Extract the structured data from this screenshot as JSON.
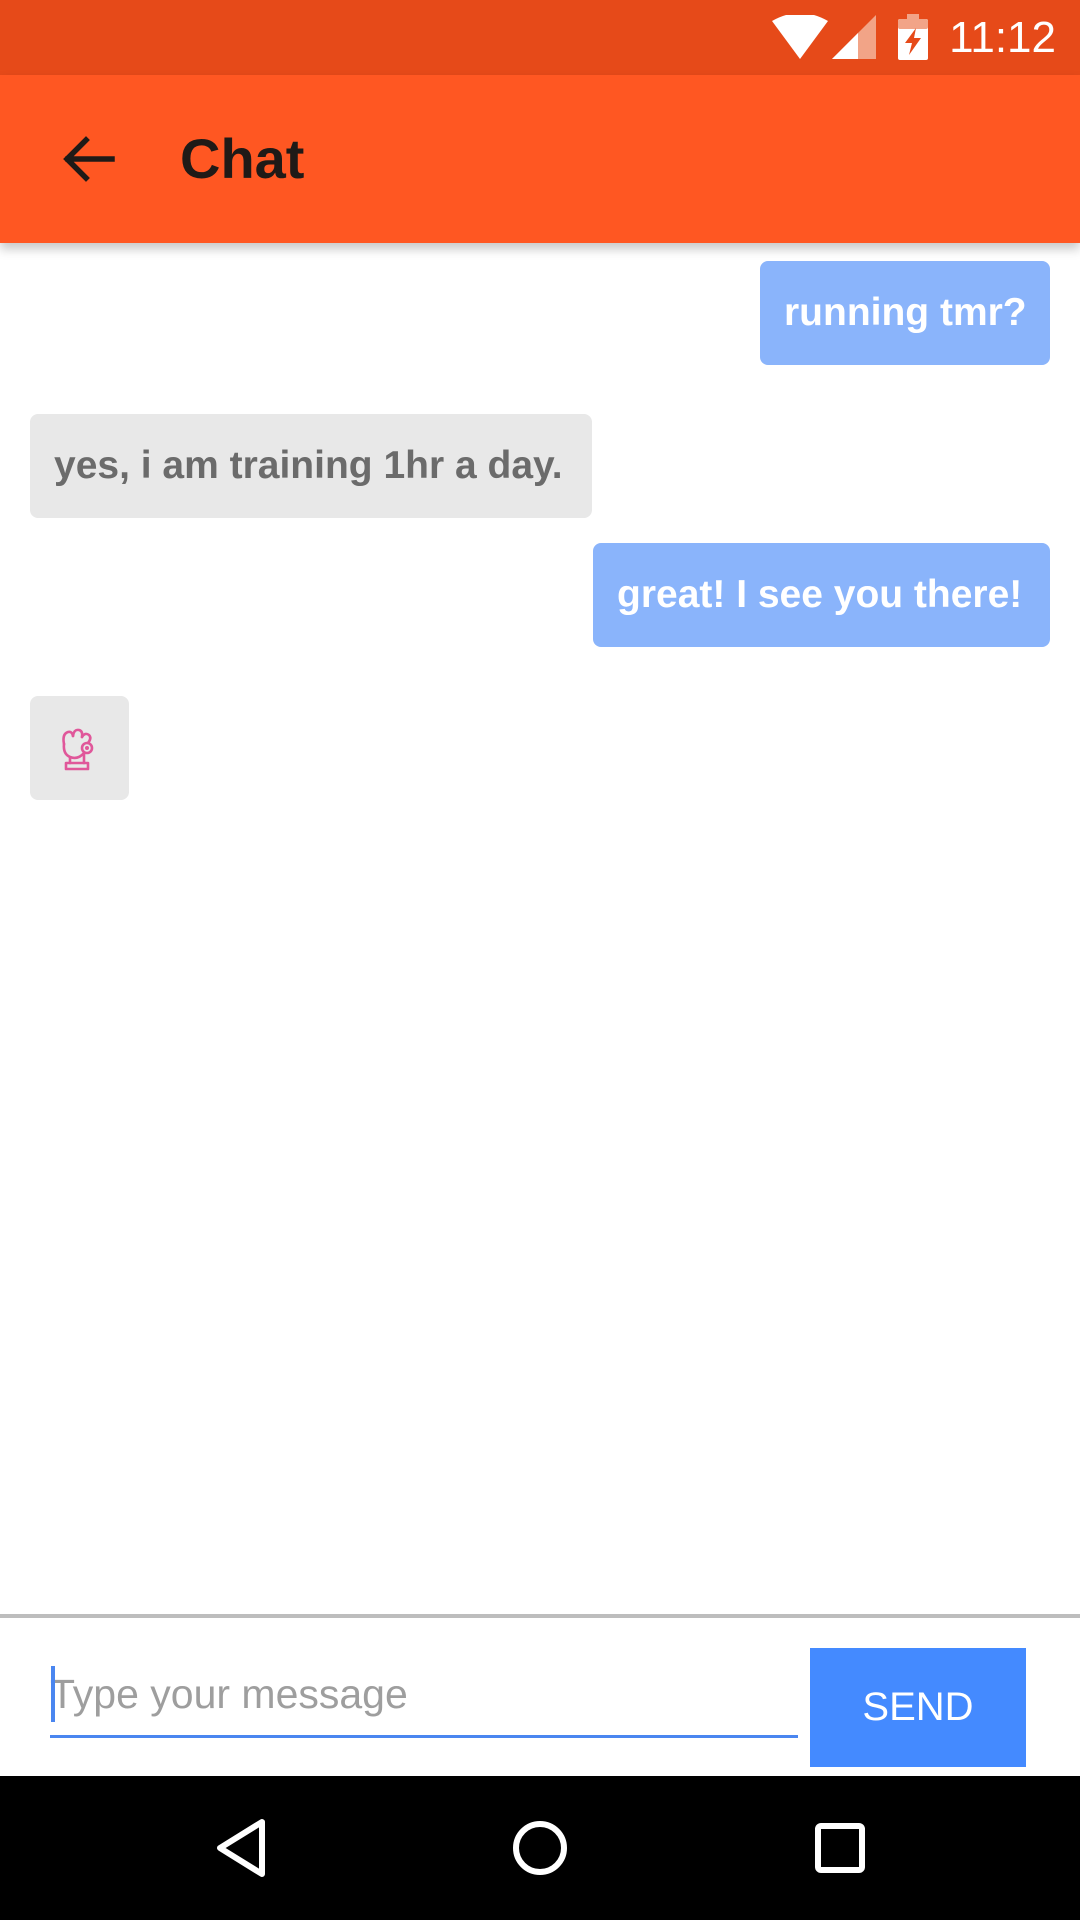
{
  "status_bar": {
    "time": "11:12",
    "icons": [
      "wifi-icon",
      "cell-signal-icon",
      "battery-charging-icon"
    ]
  },
  "app_bar": {
    "title": "Chat",
    "back_icon": "arrow-left-icon"
  },
  "messages": [
    {
      "direction": "outgoing",
      "type": "text",
      "text": "running tmr?"
    },
    {
      "direction": "incoming",
      "type": "text",
      "text": "yes, i am training 1hr a day."
    },
    {
      "direction": "outgoing",
      "type": "text",
      "text": "great! I see you there!"
    },
    {
      "direction": "incoming",
      "type": "sticker",
      "sticker": "ok-hand-icon"
    }
  ],
  "composer": {
    "placeholder": "Type your message",
    "value": "",
    "send_label": "SEND"
  },
  "nav_bar": {
    "buttons": [
      "nav-back-icon",
      "nav-home-icon",
      "nav-recents-icon"
    ]
  },
  "colors": {
    "status_bar": "#e64a19",
    "app_bar": "#ff5722",
    "outgoing_bubble": "#8ab4fb",
    "incoming_bubble": "#e8e8e8",
    "send_button": "#448aff",
    "sticker": "#e0579a"
  }
}
